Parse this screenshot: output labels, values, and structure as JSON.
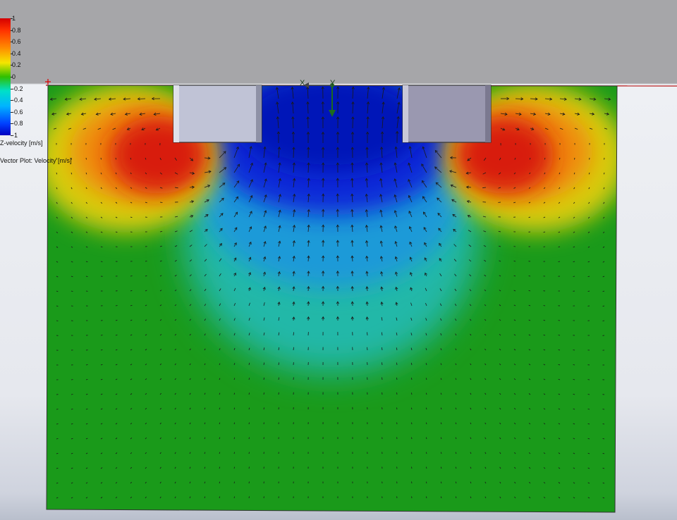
{
  "legend": {
    "ticks": [
      "1",
      "0.8",
      "0.6",
      "0.4",
      "0.2",
      "0",
      "-0.2",
      "-0.4",
      "-0.6",
      "-0.8",
      "-1"
    ],
    "scalar_caption": "Z-velocity [m/s]",
    "vector_caption": "Vector Plot: Velocity [m/s]"
  },
  "triad": {
    "y_label": "Y",
    "x_label": "X"
  },
  "colors": {
    "domain_green": "#1a9a1a",
    "block_face": "#b8bcd0",
    "outline_red": "#b00000"
  }
}
